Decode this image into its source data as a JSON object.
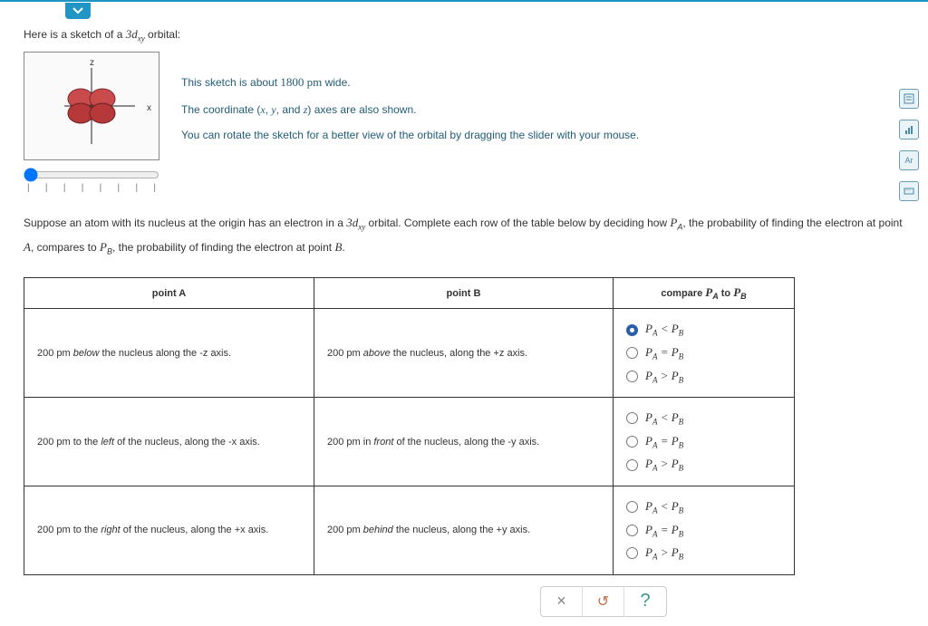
{
  "intro": {
    "prefix": "Here is a sketch of a ",
    "orbital": "3d",
    "orbital_sub": "xy",
    "suffix": " orbital:"
  },
  "axes": {
    "x": "x",
    "z": "z"
  },
  "info": {
    "line1_a": "This sketch is about ",
    "line1_b": "1800 pm",
    "line1_c": " wide.",
    "line2_a": "The coordinate (",
    "line2_x": "x",
    "line2_y": "y",
    "line2_z": "z",
    "line2_b": ", and ",
    "line2_c": ") axes are also shown.",
    "line2_sep": ", ",
    "line3": "You can rotate the sketch for a better view of the orbital by dragging the slider with your mouse."
  },
  "question": {
    "part1": "Suppose an atom with its nucleus at the origin has an electron in a ",
    "orb": "3d",
    "orb_sub": "xy",
    "part2": " orbital. Complete each row of the table below by deciding how ",
    "pa": "P",
    "pa_sub": "A",
    "part3": ", the probability of finding the electron at point ",
    "A": "A",
    "part4": ", compares to ",
    "pb": "P",
    "pb_sub": "B",
    "part5": ", the probability of finding the electron at point ",
    "B": "B",
    "part6": "."
  },
  "table": {
    "headers": {
      "a": "point A",
      "b": "point B",
      "c_prefix": "compare ",
      "c_pa": "P",
      "c_pa_sub": "A",
      "c_mid": " to ",
      "c_pb": "P",
      "c_pb_sub": "B"
    },
    "rows": [
      {
        "a_pre": "200 pm ",
        "a_em": "below",
        "a_post": " the nucleus along the -z axis.",
        "b_pre": "200 pm ",
        "b_em": "above",
        "b_post": " the nucleus, along the +z axis.",
        "selected": 0
      },
      {
        "a_pre": "200 pm to the ",
        "a_em": "left",
        "a_post": " of the nucleus, along the -x axis.",
        "b_pre": "200 pm in ",
        "b_em": "front",
        "b_post": " of the nucleus, along the -y axis.",
        "selected": -1
      },
      {
        "a_pre": "200 pm to the ",
        "a_em": "right",
        "a_post": " of the nucleus, along the +x axis.",
        "b_pre": "200 pm ",
        "b_em": "behind",
        "b_post": " the nucleus, along the +y axis.",
        "selected": -1
      }
    ],
    "options": {
      "lt": {
        "p1": "P",
        "s1": "A",
        "op": " < ",
        "p2": "P",
        "s2": "B"
      },
      "eq": {
        "p1": "P",
        "s1": "A",
        "op": " = ",
        "p2": "P",
        "s2": "B"
      },
      "gt": {
        "p1": "P",
        "s1": "A",
        "op": " > ",
        "p2": "P",
        "s2": "B"
      }
    }
  },
  "actions": {
    "clear": "×",
    "reset": "↺",
    "help": "?"
  }
}
